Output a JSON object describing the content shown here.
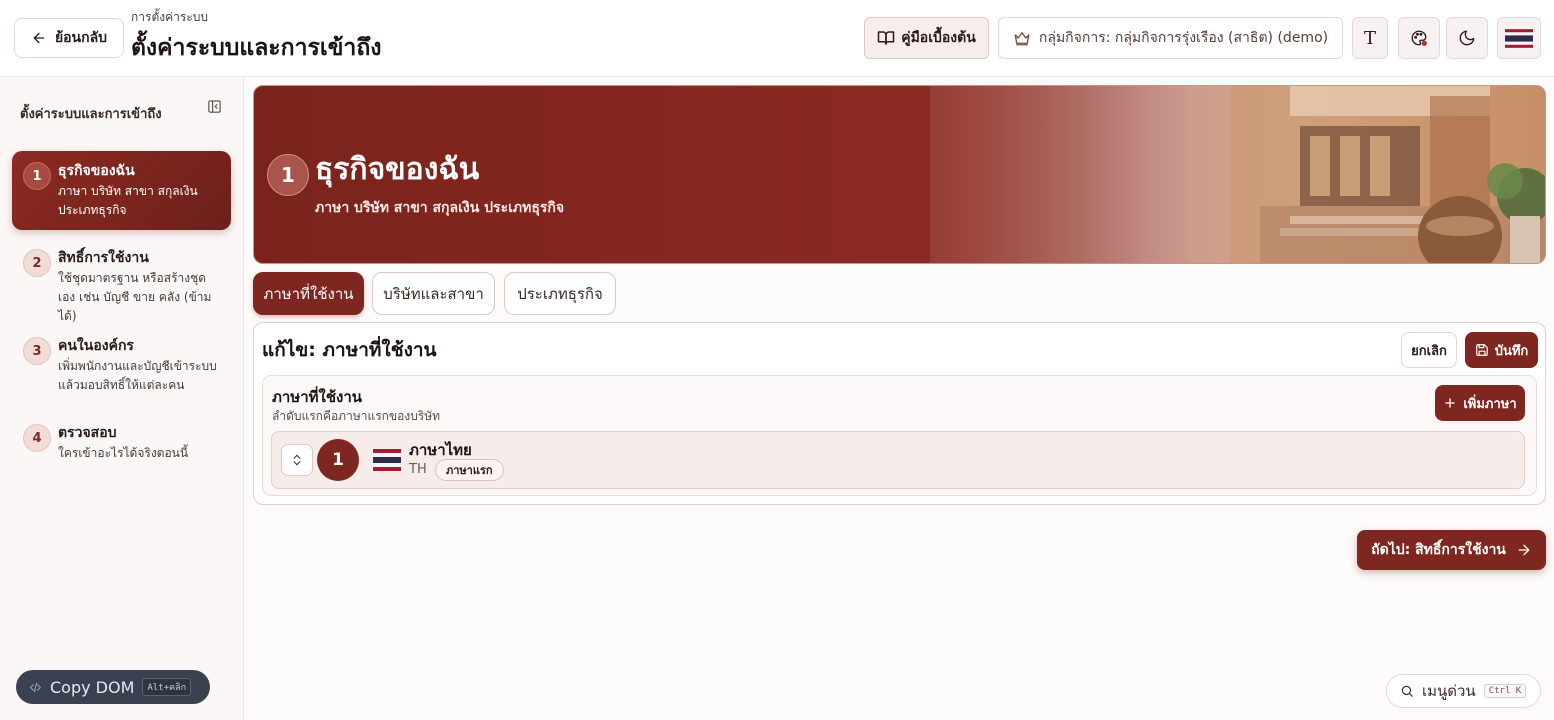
{
  "header": {
    "back_label": "ย้อนกลับ",
    "breadcrumb": "การตั้งค่าระบบ",
    "title": "ตั้งค่าระบบและการเข้าถึง",
    "guide_label": "คู่มือเบื้องต้น",
    "business_group_label": "กลุ่มกิจการ: กลุ่มกิจการรุ่งเรือง (สาธิต) (demo)",
    "font_toggle_label": "T"
  },
  "sidebar": {
    "title": "ตั้งค่าระบบและการเข้าถึง",
    "steps": [
      {
        "num": "1",
        "title": "ธุรกิจของฉัน",
        "desc": "ภาษา บริษัท สาขา สกุลเงิน ประเภทธุรกิจ"
      },
      {
        "num": "2",
        "title": "สิทธิ์การใช้งาน",
        "desc": "ใช้ชุดมาตรฐาน หรือสร้างชุดเอง เช่น บัญชี ขาย คลัง (ข้ามได้)"
      },
      {
        "num": "3",
        "title": "คนในองค์กร",
        "desc": "เพิ่มพนักงานและบัญชีเข้าระบบ แล้วมอบสิทธิ์ให้แต่ละคน"
      },
      {
        "num": "4",
        "title": "ตรวจสอบ",
        "desc": "ใครเข้าอะไรได้จริงตอนนี้"
      }
    ],
    "copy_dom_label": "Copy DOM",
    "copy_dom_shortcut": "Alt+คลิก"
  },
  "hero": {
    "num": "1",
    "title": "ธุรกิจของฉัน",
    "subtitle": "ภาษา บริษัท สาขา สกุลเงิน ประเภทธุรกิจ"
  },
  "tabs": [
    "ภาษาที่ใช้งาน",
    "บริษัทและสาขา",
    "ประเภทธุรกิจ"
  ],
  "editor": {
    "title": "แก้ไข: ภาษาที่ใช้งาน",
    "cancel_label": "ยกเลิก",
    "save_label": "บันทึก",
    "section_title": "ภาษาที่ใช้งาน",
    "section_desc": "ลำดับแรกคือภาษาแรกของบริษัท",
    "add_language_label": "เพิ่มภาษา",
    "languages": [
      {
        "order": "1",
        "name": "ภาษาไทย",
        "code": "TH",
        "badge": "ภาษาแรก"
      }
    ]
  },
  "next_label": "ถัดไป: สิทธิ์การใช้งาน",
  "quick_menu": {
    "label": "เมนูด่วน",
    "shortcut": "Ctrl K"
  },
  "colors": {
    "brand": "#7e2720",
    "brand_dark": "#6d201b",
    "surface": "#fdfbfa"
  }
}
